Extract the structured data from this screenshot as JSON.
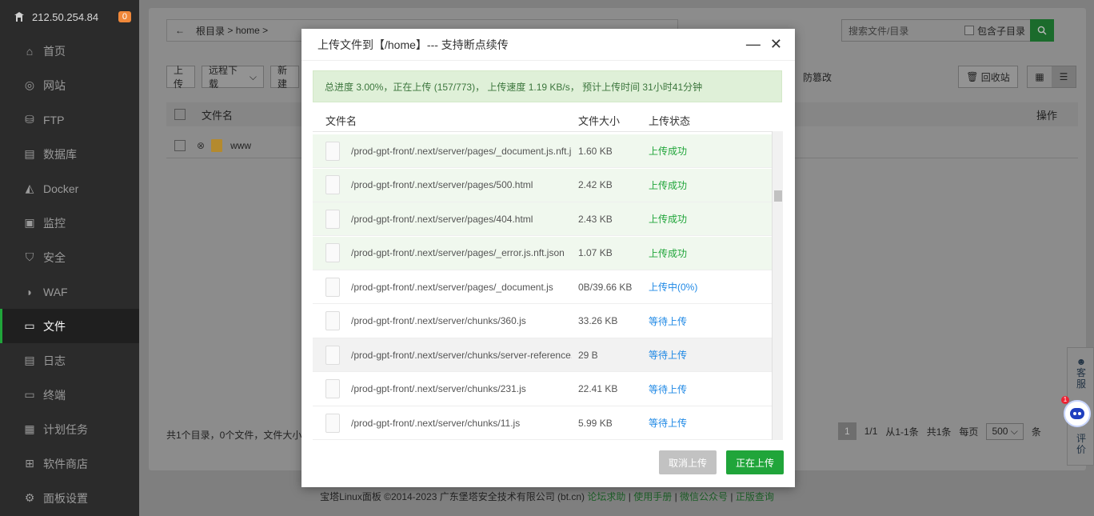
{
  "sidebar": {
    "ip": "212.50.254.84",
    "badge": "0",
    "items": [
      {
        "label": "首页",
        "icon": "home-icon"
      },
      {
        "label": "网站",
        "icon": "globe-icon"
      },
      {
        "label": "FTP",
        "icon": "ftp-icon"
      },
      {
        "label": "数据库",
        "icon": "database-icon"
      },
      {
        "label": "Docker",
        "icon": "docker-icon"
      },
      {
        "label": "监控",
        "icon": "monitor-icon"
      },
      {
        "label": "安全",
        "icon": "shield-icon"
      },
      {
        "label": "WAF",
        "icon": "waf-icon"
      },
      {
        "label": "文件",
        "icon": "folder-icon",
        "active": true
      },
      {
        "label": "日志",
        "icon": "log-icon"
      },
      {
        "label": "终端",
        "icon": "terminal-icon"
      },
      {
        "label": "计划任务",
        "icon": "calendar-icon"
      },
      {
        "label": "软件商店",
        "icon": "apps-icon"
      },
      {
        "label": "面板设置",
        "icon": "settings-icon"
      }
    ]
  },
  "filepage": {
    "crumb_root": "根目录",
    "crumb_sep": ">",
    "crumb_home": "home",
    "search_placeholder": "搜索文件/目录",
    "include_sub": "包含子目录",
    "btn_upload": "上传",
    "btn_remote": "远程下载",
    "btn_new": "新建",
    "tamper": "防篡改",
    "recycle": "回收站",
    "col_name": "文件名",
    "col_op": "操作",
    "row_name": "www",
    "summary": "共1个目录，0个文件，文件大小:",
    "pager": {
      "current": "1",
      "pages": "1/1",
      "range": "从1-1条",
      "total": "共1条",
      "per_page_label": "每页",
      "per_page": "500",
      "unit": "条"
    }
  },
  "float": {
    "kefu": "客服",
    "review": "评价",
    "dot": "1"
  },
  "copyright": {
    "text": "宝塔Linux面板 ©2014-2023 广东堡塔安全技术有限公司 (bt.cn)",
    "links": [
      "论坛求助",
      "使用手册",
      "微信公众号",
      "正版查询"
    ]
  },
  "modal": {
    "title": "上传文件到【/home】--- 支持断点续传",
    "min": "—",
    "close": "✕",
    "progress": "总进度 3.00%，正在上传 (157/773)， 上传速度 1.19 KB/s， 预计上传时间 31小时41分钟",
    "progress_fraction": 0.03,
    "col_name": "文件名",
    "col_size": "文件大小",
    "col_status": "上传状态",
    "files": [
      {
        "name": "/prod-gpt-front/.next/server/pages/_document.js.nft.j...",
        "size": "1.60 KB",
        "status": "上传成功",
        "state": "ok"
      },
      {
        "name": "/prod-gpt-front/.next/server/pages/500.html",
        "size": "2.42 KB",
        "status": "上传成功",
        "state": "ok"
      },
      {
        "name": "/prod-gpt-front/.next/server/pages/404.html",
        "size": "2.43 KB",
        "status": "上传成功",
        "state": "ok"
      },
      {
        "name": "/prod-gpt-front/.next/server/pages/_error.js.nft.json",
        "size": "1.07 KB",
        "status": "上传成功",
        "state": "ok"
      },
      {
        "name": "/prod-gpt-front/.next/server/pages/_document.js",
        "size": "0B/39.66 KB",
        "status": "上传中(0%)",
        "state": "uploading"
      },
      {
        "name": "/prod-gpt-front/.next/server/chunks/360.js",
        "size": "33.26 KB",
        "status": "等待上传",
        "state": "waiting"
      },
      {
        "name": "/prod-gpt-front/.next/server/chunks/server-reference...",
        "size": "29 B",
        "status": "等待上传",
        "state": "waiting",
        "hover": true
      },
      {
        "name": "/prod-gpt-front/.next/server/chunks/231.js",
        "size": "22.41 KB",
        "status": "等待上传",
        "state": "waiting"
      },
      {
        "name": "/prod-gpt-front/.next/server/chunks/11.js",
        "size": "5.99 KB",
        "status": "等待上传",
        "state": "waiting"
      }
    ],
    "btn_cancel": "取消上传",
    "btn_uploading": "正在上传"
  }
}
